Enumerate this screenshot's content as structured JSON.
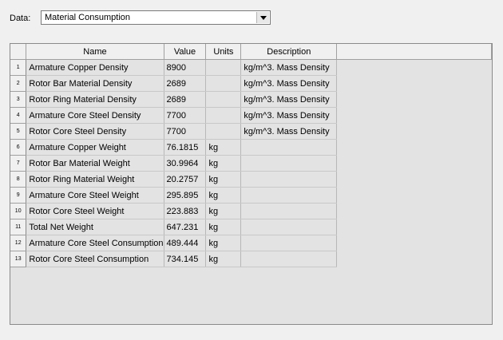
{
  "data_selector": {
    "label": "Data:",
    "selected": "Material Consumption"
  },
  "table": {
    "columns": [
      "Name",
      "Value",
      "Units",
      "Description"
    ],
    "rows": [
      {
        "num": "1",
        "name": "Armature Copper Density",
        "value": "8900",
        "units": "",
        "description": "kg/m^3. Mass Density"
      },
      {
        "num": "2",
        "name": "Rotor Bar Material Density",
        "value": "2689",
        "units": "",
        "description": "kg/m^3. Mass Density"
      },
      {
        "num": "3",
        "name": "Rotor Ring Material Density",
        "value": "2689",
        "units": "",
        "description": "kg/m^3. Mass Density"
      },
      {
        "num": "4",
        "name": "Armature Core Steel Density",
        "value": "7700",
        "units": "",
        "description": "kg/m^3. Mass Density"
      },
      {
        "num": "5",
        "name": "Rotor Core Steel Density",
        "value": "7700",
        "units": "",
        "description": "kg/m^3. Mass Density"
      },
      {
        "num": "6",
        "name": "Armature Copper Weight",
        "value": "76.1815",
        "units": "kg",
        "description": ""
      },
      {
        "num": "7",
        "name": "Rotor Bar Material Weight",
        "value": "30.9964",
        "units": "kg",
        "description": ""
      },
      {
        "num": "8",
        "name": "Rotor Ring Material Weight",
        "value": "20.2757",
        "units": "kg",
        "description": ""
      },
      {
        "num": "9",
        "name": "Armature Core Steel Weight",
        "value": "295.895",
        "units": "kg",
        "description": ""
      },
      {
        "num": "10",
        "name": "Rotor Core Steel Weight",
        "value": "223.883",
        "units": "kg",
        "description": ""
      },
      {
        "num": "11",
        "name": "Total Net Weight",
        "value": "647.231",
        "units": "kg",
        "description": ""
      },
      {
        "num": "12",
        "name": "Armature Core Steel Consumption",
        "value": "489.444",
        "units": "kg",
        "description": ""
      },
      {
        "num": "13",
        "name": "Rotor Core Steel Consumption",
        "value": "734.145",
        "units": "kg",
        "description": ""
      }
    ]
  }
}
